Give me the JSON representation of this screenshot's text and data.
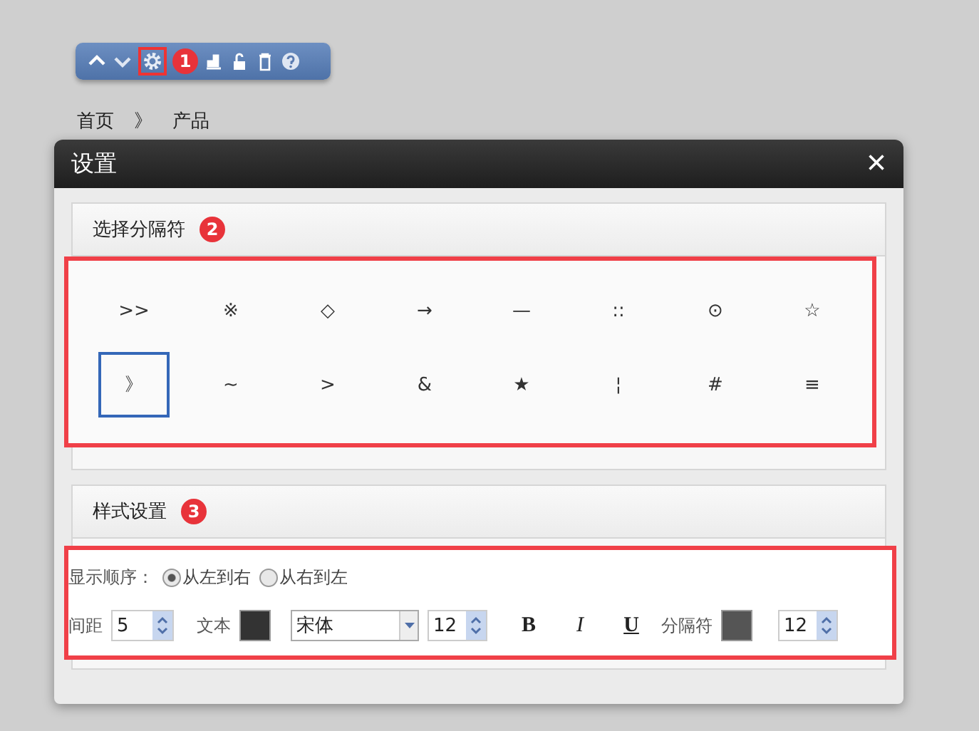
{
  "toolbar": {
    "badge": "1"
  },
  "breadcrumb": {
    "items": [
      "首页",
      "》",
      "产品"
    ]
  },
  "dialog": {
    "title": "设置",
    "close": "×",
    "separator_section": {
      "title": "选择分隔符",
      "badge": "2",
      "separators": [
        {
          "symbol": ">>",
          "selected": false
        },
        {
          "symbol": "※",
          "selected": false
        },
        {
          "symbol": "◇",
          "selected": false
        },
        {
          "symbol": "→",
          "selected": false
        },
        {
          "symbol": "—",
          "selected": false
        },
        {
          "symbol": "::",
          "selected": false
        },
        {
          "symbol": "⊙",
          "selected": false
        },
        {
          "symbol": "☆",
          "selected": false
        },
        {
          "symbol": "》",
          "selected": true
        },
        {
          "symbol": "~",
          "selected": false
        },
        {
          "symbol": ">",
          "selected": false
        },
        {
          "symbol": "&",
          "selected": false
        },
        {
          "symbol": "★",
          "selected": false
        },
        {
          "symbol": "¦",
          "selected": false
        },
        {
          "symbol": "#",
          "selected": false
        },
        {
          "symbol": "≡",
          "selected": false
        }
      ]
    },
    "style_section": {
      "title": "样式设置",
      "badge": "3",
      "order_label": "显示顺序：",
      "order_options": [
        {
          "label": "从左到右",
          "selected": true
        },
        {
          "label": "从右到左",
          "selected": false
        }
      ],
      "spacing_label": "间距",
      "spacing": "5",
      "text_label": "文本",
      "text_swatch": {
        "color": "#333333"
      },
      "font": "宋体",
      "font_size": "12",
      "bold": "B",
      "italic": "I",
      "underline": "U",
      "separator_label": "分隔符",
      "separator_swatch": {
        "color": "#555555"
      },
      "separator_size": "12"
    }
  }
}
